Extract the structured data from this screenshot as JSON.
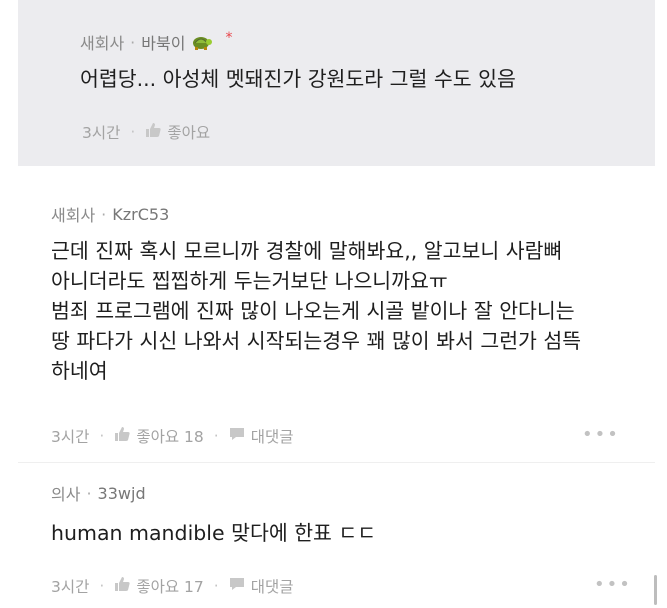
{
  "comments": [
    {
      "job": "새회사",
      "author": "바북이",
      "badge": "*",
      "body": [
        "어렵당... 아성체 멧돼진가 강원도라 그럴 수도 있음"
      ],
      "time": "3시간",
      "likes": "좋아요"
    },
    {
      "job": "새회사",
      "author": "KzrC53",
      "body": [
        "근데 진짜 혹시 모르니까 경찰에 말해봐요,, 알고보니 사람뼈",
        "아니더라도 찝찝하게 두는거보단 나으니까요ㅠ",
        "범죄 프로그램에 진짜 많이 나오는게 시골 밭이나 잘 안다니는",
        "땅 파다가 시신 나와서 시작되는경우 꽤 많이 봐서 그런가 섬뜩",
        "하네여"
      ],
      "time": "3시간",
      "likes": "좋아요 18",
      "reply": "대댓글",
      "more": "•••"
    },
    {
      "job": "의사",
      "author": "33wjd",
      "body": [
        "human mandible 맞다에 한표 ㄷㄷ"
      ],
      "time": "3시간",
      "likes": "좋아요 17",
      "reply": "대댓글",
      "more": "•••"
    }
  ]
}
